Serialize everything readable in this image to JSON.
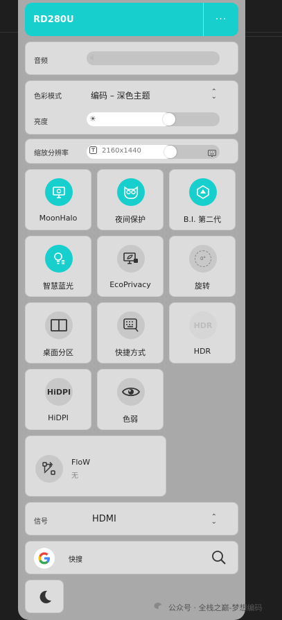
{
  "header": {
    "title": "RD280U",
    "more": "···"
  },
  "audio": {
    "label": "音频",
    "level": 0
  },
  "color": {
    "label": "色彩模式",
    "value": "编码 – 深色主题",
    "brightness_label": "亮度",
    "brightness_level": 0.63
  },
  "scale": {
    "label": "缩放分辨率",
    "value": "2160x1440",
    "level": 0.64
  },
  "tiles": [
    {
      "label": "MoonHalo",
      "icon": "moonhalo-icon",
      "active": true
    },
    {
      "label": "夜间保护",
      "icon": "owl-icon",
      "active": true
    },
    {
      "label": "B.I. 第二代",
      "icon": "bi-gen2-icon",
      "active": true
    },
    {
      "label": "智慧蓝光",
      "icon": "smart-bluelight-icon",
      "active": true
    },
    {
      "label": "EcoPrivacy",
      "icon": "ecoprivacy-icon",
      "active": false
    },
    {
      "label": "旋转",
      "icon": "rotate-icon",
      "active": false,
      "badge": "0°"
    },
    {
      "label": "桌面分区",
      "icon": "desktop-partition-icon",
      "active": false
    },
    {
      "label": "快捷方式",
      "icon": "keyboard-shortcut-icon",
      "active": false
    },
    {
      "label": "HDR",
      "icon": "hdr-icon",
      "active": false,
      "icon_text": "HDR"
    },
    {
      "label": "HiDPI",
      "icon": "hidpi-icon",
      "active": false,
      "icon_text": "HiDPI"
    },
    {
      "label": "色弱",
      "icon": "eye-icon",
      "active": false
    }
  ],
  "flow": {
    "title": "FloW",
    "subtitle": "无"
  },
  "signal": {
    "label": "信号",
    "value": "HDMI"
  },
  "search": {
    "label": "快搜"
  },
  "watermark": {
    "text": "公众号 · 全栈之巅-梦想编码"
  },
  "colors": {
    "accent": "#17cfcc",
    "panel": "#a9a9a9",
    "card": "#dcdcdc"
  }
}
